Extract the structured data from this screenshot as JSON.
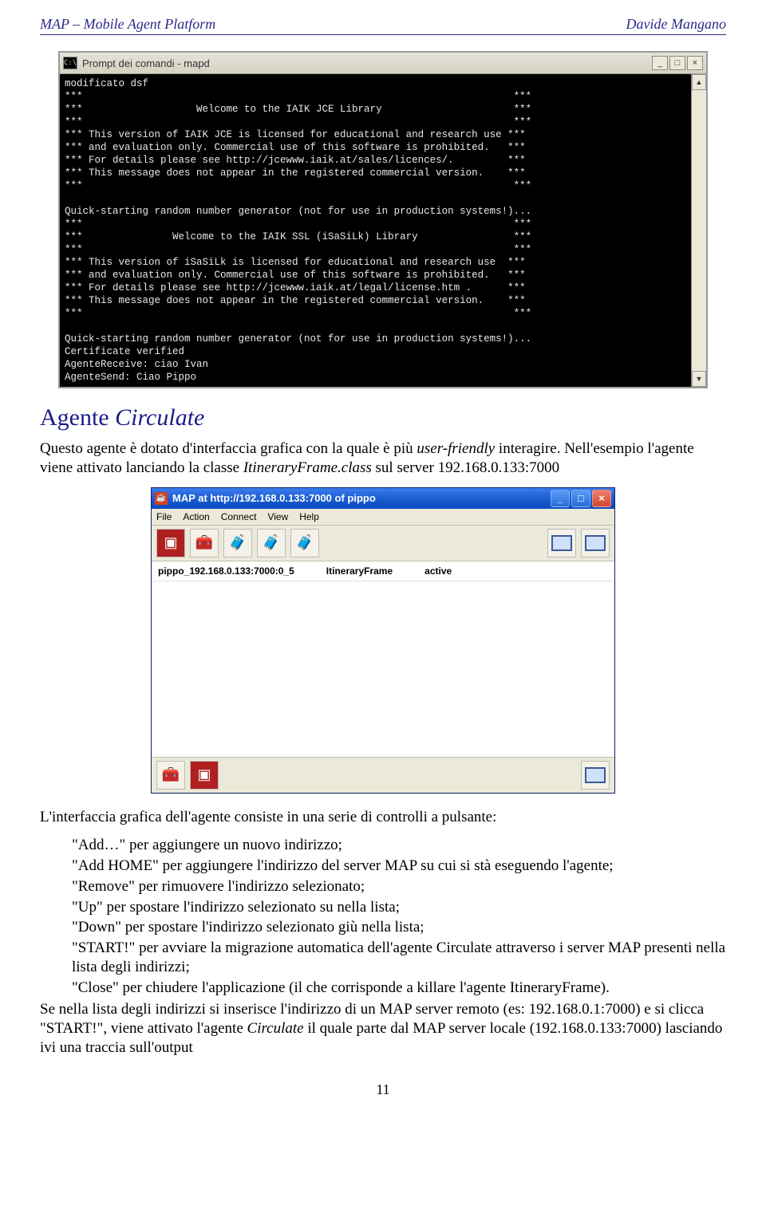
{
  "header": {
    "left": "MAP – Mobile Agent Platform",
    "right": "Davide Mangano"
  },
  "console": {
    "titlebar_icon": "C:\\",
    "title": "Prompt dei comandi - mapd",
    "min": "_",
    "max": "□",
    "close": "×",
    "up": "▲",
    "down": "▼",
    "text": "modificato dsf\n***                                                                        ***\n***                   Welcome to the IAIK JCE Library                      ***\n***                                                                        ***\n*** This version of IAIK JCE is licensed for educational and research use ***\n*** and evaluation only. Commercial use of this software is prohibited.   ***\n*** For details please see http://jcewww.iaik.at/sales/licences/.         ***\n*** This message does not appear in the registered commercial version.    ***\n***                                                                        ***\n\nQuick-starting random number generator (not for use in production systems!)...\n***                                                                        ***\n***               Welcome to the IAIK SSL (iSaSiLk) Library                ***\n***                                                                        ***\n*** This version of iSaSiLk is licensed for educational and research use  ***\n*** and evaluation only. Commercial use of this software is prohibited.   ***\n*** For details please see http://jcewww.iaik.at/legal/license.htm .      ***\n*** This message does not appear in the registered commercial version.    ***\n***                                                                        ***\n\nQuick-starting random number generator (not for use in production systems!)...\nCertificate verified\nAgenteReceive: ciao Ivan\nAgenteSend: Ciao Pippo"
  },
  "section": {
    "title_a": "Agente ",
    "title_b": "Circulate"
  },
  "p1": {
    "t1": "Questo agente è dotato d'interfaccia grafica con la quale è più ",
    "it1": "user-friendly",
    "t2": " interagire. Nell'esempio l'agente viene attivato lanciando la classe ",
    "it2": "ItineraryFrame.class",
    "t3": " sul server 192.168.0.133:7000"
  },
  "java": {
    "title": "MAP at http://192.168.0.133:7000 of pippo",
    "menu": {
      "file": "File",
      "action": "Action",
      "connect": "Connect",
      "view": "View",
      "help": "Help"
    },
    "row": {
      "col1": "pippo_192.168.0.133:7000:0_5",
      "col2": "ItineraryFrame",
      "col3": "active"
    },
    "min": "_",
    "max": "□",
    "close": "×"
  },
  "p2": "L'interfaccia grafica dell'agente consiste in una serie di controlli a pulsante:",
  "bullets": {
    "b1": "\"Add…\" per aggiungere un nuovo indirizzo;",
    "b2": "\"Add HOME\" per aggiungere l'indirizzo del server MAP su cui si stà eseguendo l'agente;",
    "b3": "\"Remove\" per rimuovere l'indirizzo selezionato;",
    "b4": "\"Up\" per spostare l'indirizzo selezionato su nella lista;",
    "b5": "\"Down\" per spostare l'indirizzo selezionato giù nella lista;",
    "b6a": "\"START!\" per avviare la migrazione automatica dell'agente ",
    "b6b": "Circulate",
    "b6c": " attraverso i server MAP presenti nella lista degli indirizzi;",
    "b7": "\"Close\" per chiudere l'applicazione (il che corrisponde a killare l'agente ItineraryFrame)."
  },
  "p3": {
    "t1": "Se nella lista degli indirizzi si inserisce l'indirizzo di un MAP server remoto (es: 192.168.0.1:7000) e si clicca \"START!\", viene attivato l'agente ",
    "it1": "Circulate",
    "t2": " il quale parte dal MAP server locale (192.168.0.133:7000) lasciando ivi una traccia sull'output"
  },
  "page_number": "11"
}
